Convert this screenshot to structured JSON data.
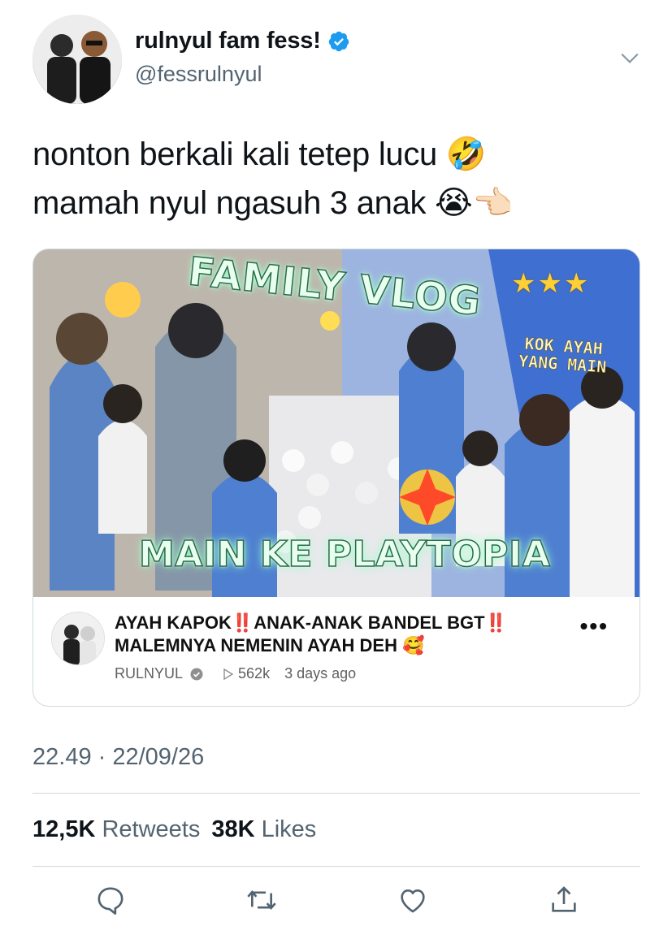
{
  "tweet": {
    "display_name": "rulnyul fam fess!",
    "handle": "@fessrulnyul",
    "verified": true,
    "text_lines": [
      "nonton berkali kali tetep lucu 🤣",
      "mamah nyul ngasuh 3 anak 😭👈🏻"
    ],
    "timestamp": "22.49 · 22/09/26",
    "retweets_count": "12,5K",
    "retweets_label": "Retweets",
    "likes_count": "38K",
    "likes_label": "Likes"
  },
  "card": {
    "thumbnail": {
      "headline": "FAMILY VLOG",
      "subheadline": "MAIN KE PLAYTOPIA",
      "note": "KOK AYAH YANG MAIN",
      "stars": "★★★"
    },
    "video_title_line1": "AYAH KAPOK‼️ANAK-ANAK BANDEL BGT‼️",
    "video_title_line2": "MALEMNYA NEMENIN AYAH DEH 🥰",
    "channel": "RULNYUL",
    "views": "562k",
    "posted": "3 days ago",
    "more_label": "•••"
  },
  "icons": {
    "caret": "chevron-down-icon",
    "verified": "verified-badge-icon",
    "reply": "reply-icon",
    "retweet": "retweet-icon",
    "like": "heart-icon",
    "share": "share-icon"
  },
  "colors": {
    "verified_blue": "#1d9bf0",
    "secondary_text": "#536471",
    "divider": "#cfd9de"
  }
}
